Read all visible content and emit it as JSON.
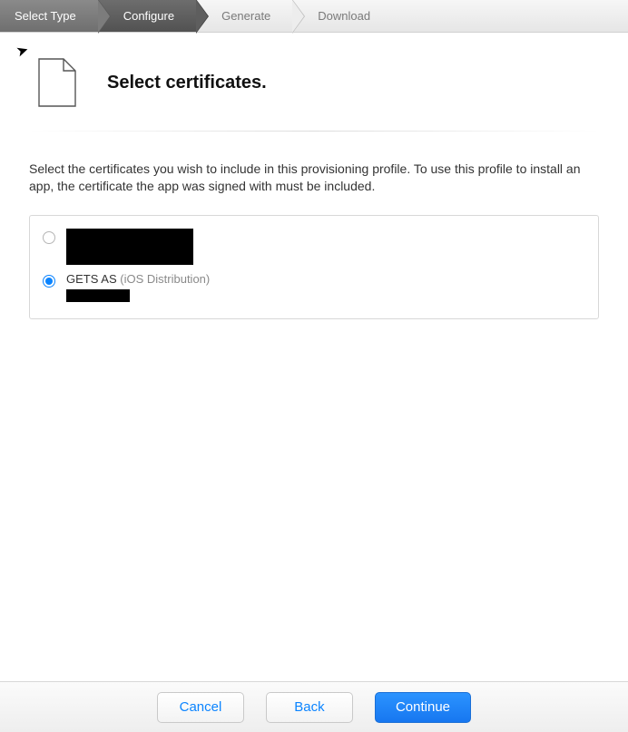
{
  "stepper": {
    "steps": [
      {
        "label": "Select Type",
        "state": "done"
      },
      {
        "label": "Configure",
        "state": "active"
      },
      {
        "label": "Generate",
        "state": "upcoming"
      },
      {
        "label": "Download",
        "state": "upcoming"
      }
    ]
  },
  "page": {
    "title": "Select certificates.",
    "description": "Select the certificates you wish to include in this provisioning profile. To use this profile to install an app, the certificate the app was signed with must be included."
  },
  "certificates": {
    "items": [
      {
        "selected": false,
        "name_redacted": true,
        "name": "",
        "subtitle": ""
      },
      {
        "selected": true,
        "name_redacted": false,
        "name": "GETS AS",
        "subtitle": "(iOS Distribution)",
        "detail_redacted": true
      }
    ]
  },
  "footer": {
    "cancel": "Cancel",
    "back": "Back",
    "continue": "Continue"
  },
  "colors": {
    "accent": "#0b84ff"
  }
}
